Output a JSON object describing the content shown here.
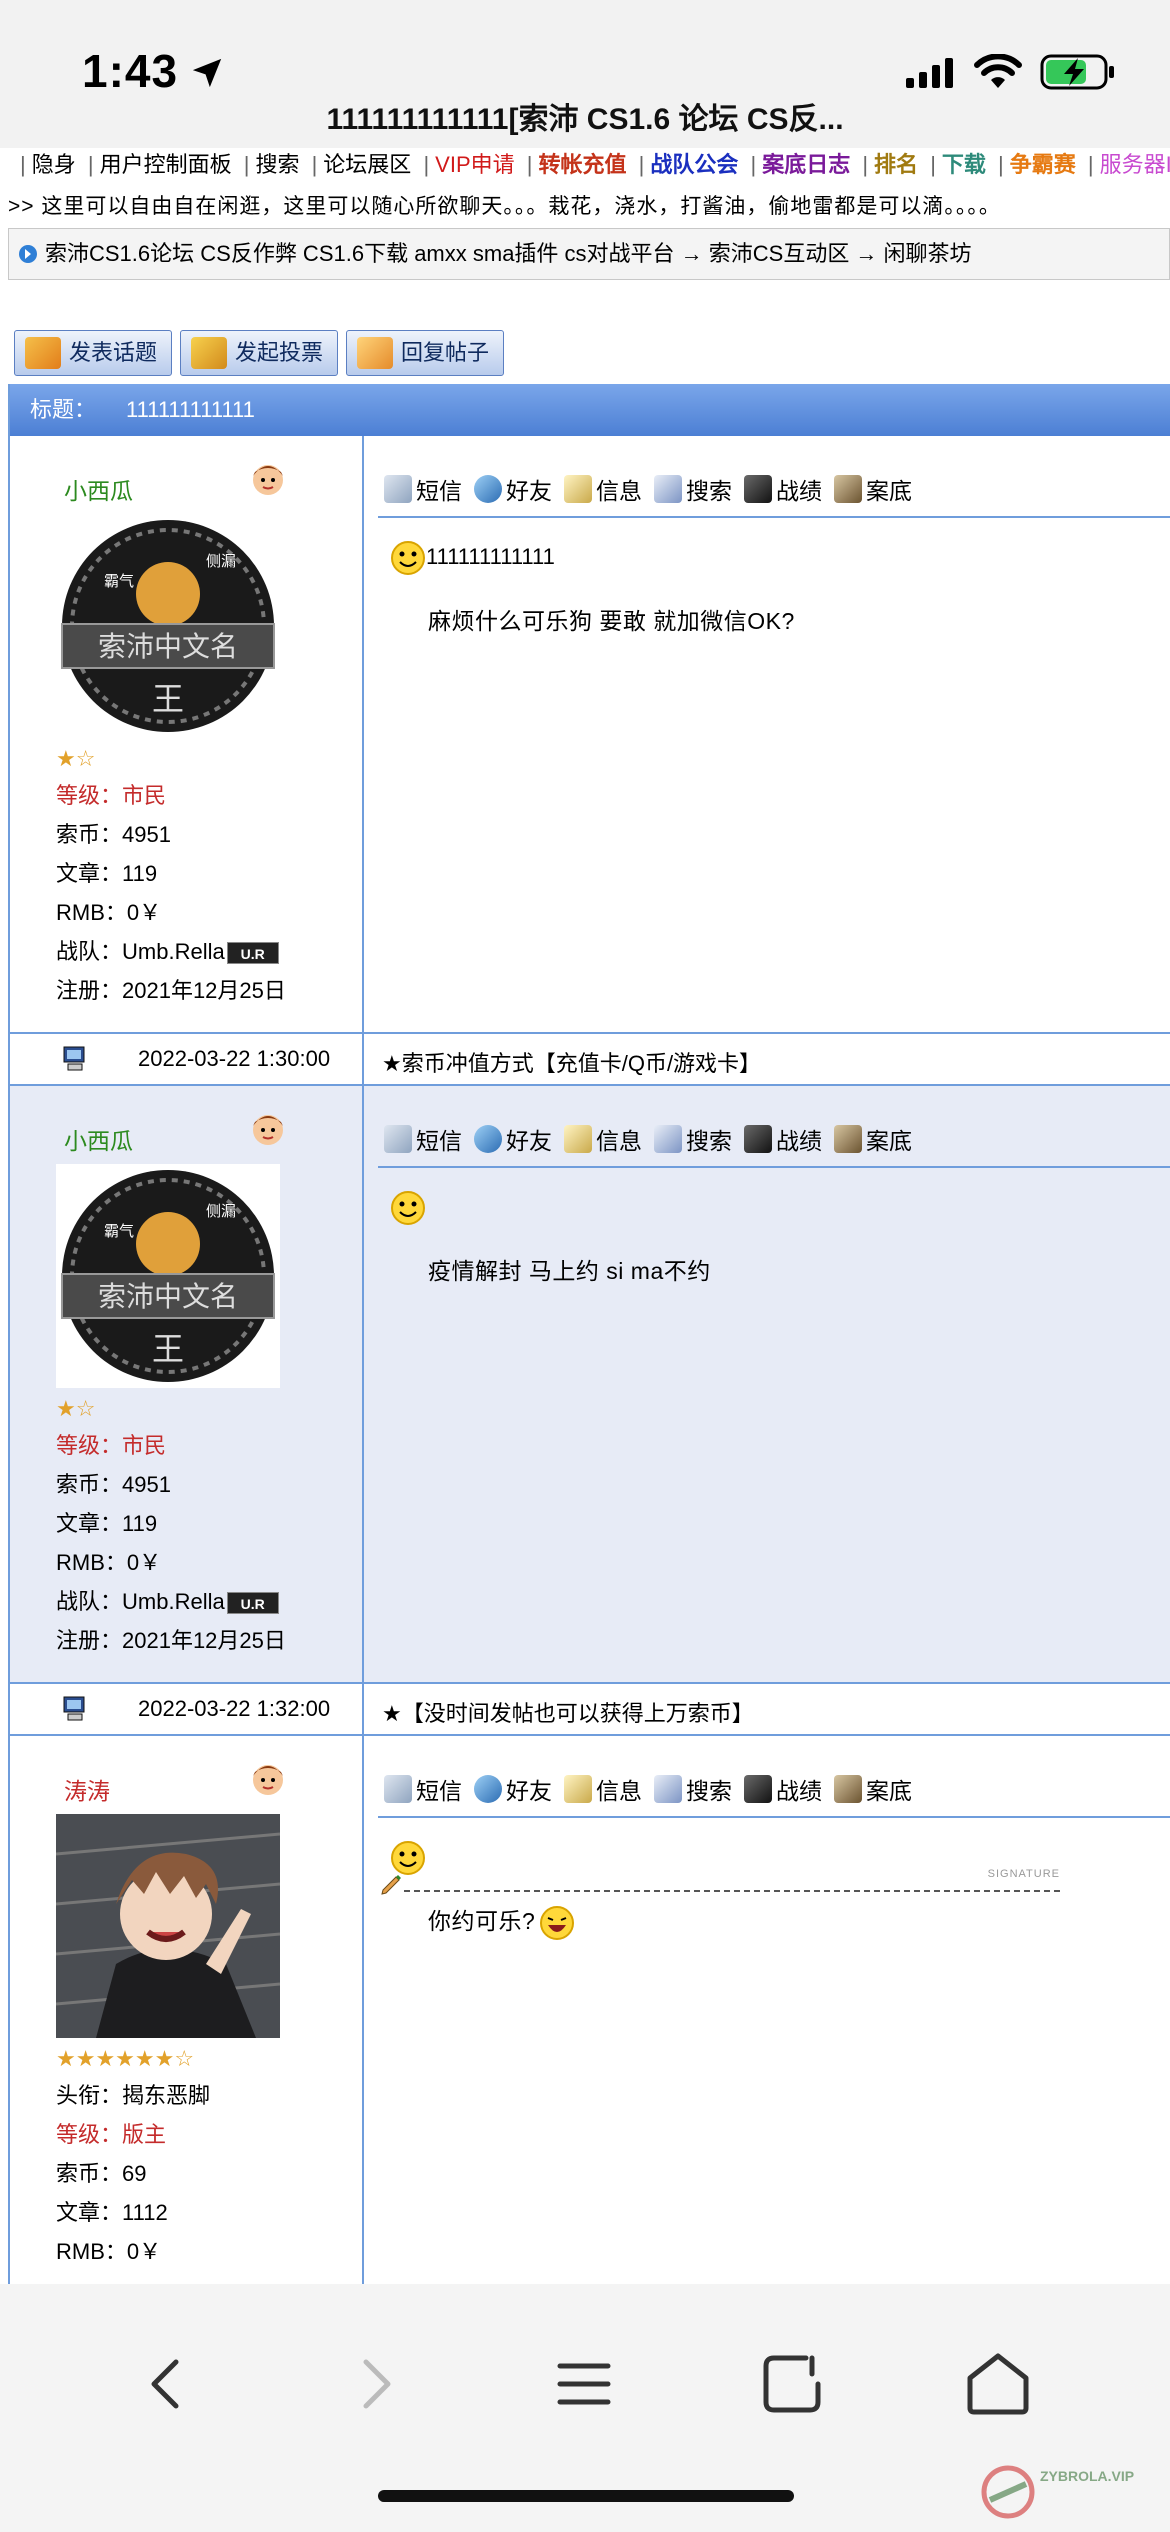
{
  "status_bar": {
    "time": "1:43"
  },
  "browser": {
    "page_title": "111111111111[索沛 CS1.6 论坛 CS反..."
  },
  "nav": {
    "items": [
      {
        "label": "隐身",
        "color": "#000000"
      },
      {
        "label": "用户控制面板",
        "color": "#000000"
      },
      {
        "label": "搜索",
        "color": "#000000"
      },
      {
        "label": "论坛展区",
        "color": "#000000"
      },
      {
        "label": "VIP申请",
        "color": "#d11a1a"
      },
      {
        "label": "转帐充值",
        "color": "#c4331a"
      },
      {
        "label": "战队公会",
        "color": "#1a2fbf"
      },
      {
        "label": "案底日志",
        "color": "#7a1a9a"
      },
      {
        "label": "排名",
        "color": "#a07a10"
      },
      {
        "label": "下载",
        "color": "#2d8a7a"
      },
      {
        "label": "争霸赛",
        "color": "#e67a12"
      },
      {
        "label": "服务器II",
        "color": "#c84ad0"
      }
    ]
  },
  "marquee": ">> 这里可以自由自在闲逛，这里可以随心所欲聊天。。。栽花，浇水，打酱油，偷地雷都是可以滴。。。。",
  "breadcrumb": "索沛CS1.6论坛 CS反作弊 CS1.6下载 amxx sma插件 cs对战平台 → 索沛CS互动区 → 闲聊茶坊",
  "actions": {
    "post": "发表话题",
    "vote": "发起投票",
    "reply": "回复帖子"
  },
  "thread": {
    "title_label": "标题：",
    "title": "111111111111"
  },
  "toolbar": {
    "msg": "短信",
    "friend": "好友",
    "info": "信息",
    "search": "搜索",
    "record": "战绩",
    "case": "案底"
  },
  "posts": [
    {
      "username": "小西瓜",
      "stars": "★☆",
      "level_label": "等级：",
      "level": "市民",
      "coins": "索币：4951",
      "articles": "文章：119",
      "rmb": "RMB：0￥",
      "team_label": "战队：",
      "team": "Umb.Rella",
      "team_badge": "U.R",
      "register": "注册：2021年12月25日",
      "title": "111111111111",
      "body": "麻烦什么可乐狗  要敢  就加微信OK?",
      "footer_time": "2022-03-22 1:30:00",
      "footer_note": "★索币冲值方式【充值卡/Q币/游戏卡】"
    },
    {
      "username": "小西瓜",
      "stars": "★☆",
      "level_label": "等级：",
      "level": "市民",
      "coins": "索币：4951",
      "articles": "文章：119",
      "rmb": "RMB：0￥",
      "team_label": "战队：",
      "team": "Umb.Rella",
      "team_badge": "U.R",
      "register": "注册：2021年12月25日",
      "title": "",
      "body": "疫情解封  马上约 si ma不约",
      "footer_time": "2022-03-22 1:32:00",
      "footer_note": "★【没时间发帖也可以获得上万索币】"
    },
    {
      "username": "涛涛",
      "stars": "★★★★★★☆",
      "rank_title": "头衔：揭东恶脚",
      "level_label": "等级：",
      "level": "版主",
      "coins": "索币：69",
      "articles": "文章：1112",
      "rmb": "RMB：0￥",
      "title": "",
      "body": "你约可乐?"
    }
  ],
  "avatar_text": {
    "banner": "索沛中文名",
    "left": "霸气",
    "right": "侧漏",
    "bottom": "王"
  },
  "signature_label": "SIGNATURE",
  "watermark": "ZYBROLA.VIP"
}
